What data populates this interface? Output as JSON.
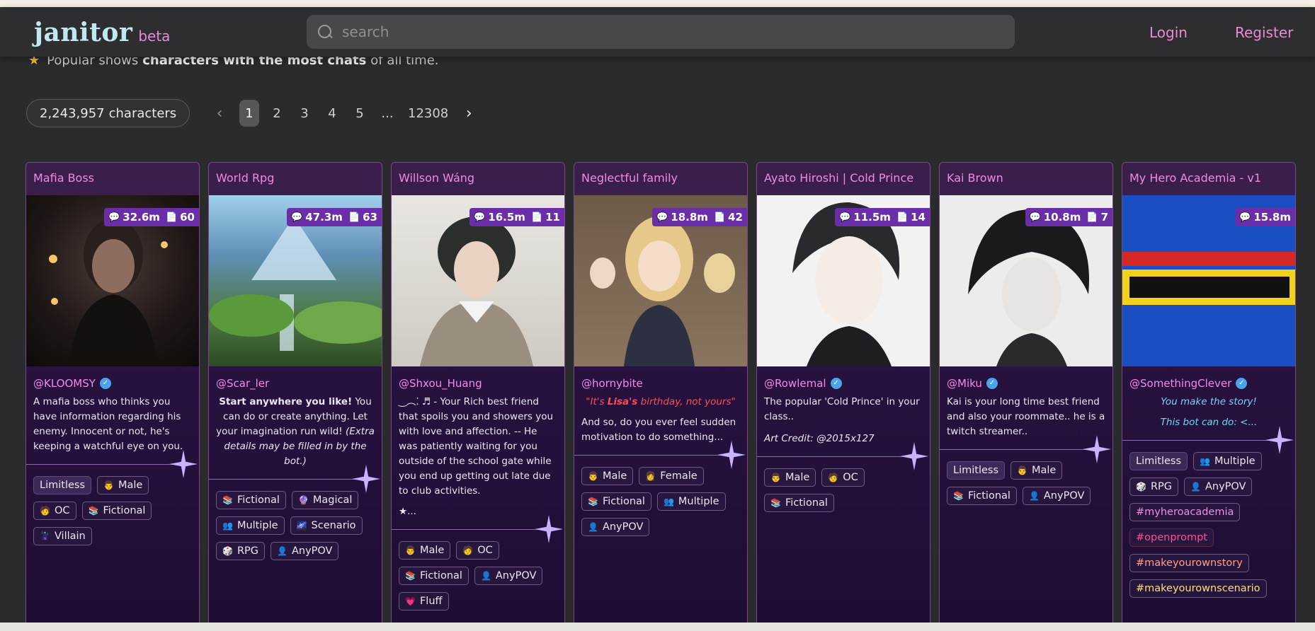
{
  "navbar": {
    "logo": "janitor",
    "beta": "beta",
    "search_placeholder": "search",
    "login": "Login",
    "register": "Register"
  },
  "popular": {
    "prefix": "Popular shows",
    "bold": "characters with the most chats",
    "suffix": "of all time."
  },
  "count": {
    "number": "2,243,957",
    "label": "characters"
  },
  "pagination": {
    "prev": "‹",
    "pages": [
      "1",
      "2",
      "3",
      "4",
      "5",
      "...",
      "12308"
    ],
    "next": "›",
    "active": "1"
  },
  "cards": [
    {
      "title": "Mafia Boss",
      "chats": "32.6m",
      "msgs": "60",
      "creator": "@KLOOMSY",
      "verified": true,
      "desc": [
        "A mafia boss who thinks you have information regarding his enemy. Innocent or not, he's keeping a watchful eye on you."
      ],
      "tags": [
        "Limitless",
        "Male",
        "OC",
        "Fictional",
        "Villain"
      ]
    },
    {
      "title": "World Rpg",
      "chats": "47.3m",
      "msgs": "63",
      "creator": "@Scar_ler",
      "verified": false,
      "desc_bold": "Start anywhere you like!",
      "desc_rest": " You can do or create anything. Let your imagination run wild! ",
      "desc_italic": "(Extra details may be filled in by the bot.)",
      "tags": [
        "Fictional",
        "Magical",
        "Multiple",
        "Scenario",
        "RPG",
        "AnyPOV"
      ]
    },
    {
      "title": "Willson Wáng",
      "chats": "16.5m",
      "msgs": "11",
      "creator": "@Shxou_Huang",
      "verified": false,
      "desc": [
        "‿︵⁚ ♬ - Your Rich best friend that spoils you and showers you with love and affection. -- He was patiently waiting for you outside of the school gate while you end up getting out late due to club activities.",
        "★..."
      ],
      "tags": [
        "Male",
        "OC",
        "Fictional",
        "AnyPOV",
        "Fluff"
      ]
    },
    {
      "title": "Neglectful family",
      "chats": "18.8m",
      "msgs": "42",
      "creator": "@hornybite",
      "verified": false,
      "desc_q1": "\"It's ",
      "desc_q2": "Lisa's",
      "desc_q3": " birthday, not yours\"",
      "desc": [
        "And so, do you ever feel sudden motivation to do something..."
      ],
      "tags": [
        "Male",
        "Female",
        "Fictional",
        "Multiple",
        "AnyPOV"
      ]
    },
    {
      "title": "Ayato Hiroshi | Cold Prince",
      "chats": "11.5m",
      "msgs": "14",
      "creator": "@Rowlemal",
      "verified": true,
      "desc": [
        "The popular 'Cold Prince' in your class..",
        "Art Credit: @2015x127"
      ],
      "tags": [
        "Male",
        "OC",
        "Fictional"
      ]
    },
    {
      "title": "Kai Brown",
      "chats": "10.8m",
      "msgs": "7",
      "creator": "@Miku",
      "verified": true,
      "desc": [
        "Kai is your long time best friend and also your roommate.. he is a twitch streamer.."
      ],
      "tags": [
        "Limitless",
        "Male",
        "Fictional",
        "AnyPOV"
      ]
    },
    {
      "title": "My Hero Academia - v1",
      "chats": "15.8m",
      "msgs": "",
      "creator": "@SomethingClever",
      "verified": true,
      "desc": [
        "You make the story!",
        "This bot can do: <..."
      ],
      "tags": [
        "Limitless",
        "Multiple",
        "RPG",
        "AnyPOV",
        "#myheroacademia",
        "#openprompt",
        "#makeyourownstory",
        "#makeyourownscenario"
      ]
    }
  ],
  "tag_icons": {
    "Male": "👨",
    "Female": "👩",
    "OC": "🧑",
    "Fictional": "📚",
    "Villain": "🦹",
    "Magical": "🔮",
    "Multiple": "👥",
    "Scenario": "🌌",
    "RPG": "🎲",
    "AnyPOV": "👤",
    "Fluff": "💗"
  },
  "colors": {
    "accent_pink": "#ea8ad6",
    "stats_purple": "#6a2fa8",
    "card_bg": "#281240",
    "verified_blue": "#4ba3e8"
  }
}
